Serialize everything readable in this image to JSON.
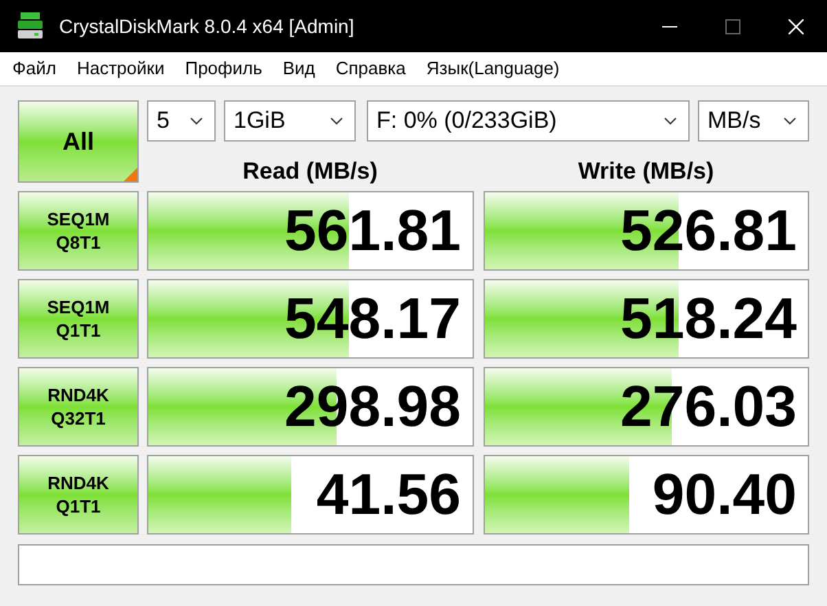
{
  "window": {
    "title": "CrystalDiskMark 8.0.4 x64 [Admin]"
  },
  "menu": [
    "Файл",
    "Настройки",
    "Профиль",
    "Вид",
    "Справка",
    "Язык(Language)"
  ],
  "all_button": {
    "label": "All"
  },
  "selectors": [
    {
      "value": "5"
    },
    {
      "value": "1GiB"
    },
    {
      "value": "F: 0% (0/233GiB)"
    },
    {
      "value": "MB/s"
    }
  ],
  "columns": [
    "Read (MB/s)",
    "Write (MB/s)"
  ],
  "tests": [
    {
      "line1": "SEQ1M",
      "line2": "Q8T1",
      "read": {
        "value": "561.81",
        "level": 0.62
      },
      "write": {
        "value": "526.81",
        "level": 0.6
      }
    },
    {
      "line1": "SEQ1M",
      "line2": "Q1T1",
      "read": {
        "value": "548.17",
        "level": 0.62
      },
      "write": {
        "value": "518.24",
        "level": 0.6
      }
    },
    {
      "line1": "RND4K",
      "line2": "Q32T1",
      "read": {
        "value": "298.98",
        "level": 0.58
      },
      "write": {
        "value": "276.03",
        "level": 0.58
      }
    },
    {
      "line1": "RND4K",
      "line2": "Q1T1",
      "read": {
        "value": "41.56",
        "level": 0.44
      },
      "write": {
        "value": "90.40",
        "level": 0.45
      }
    }
  ]
}
